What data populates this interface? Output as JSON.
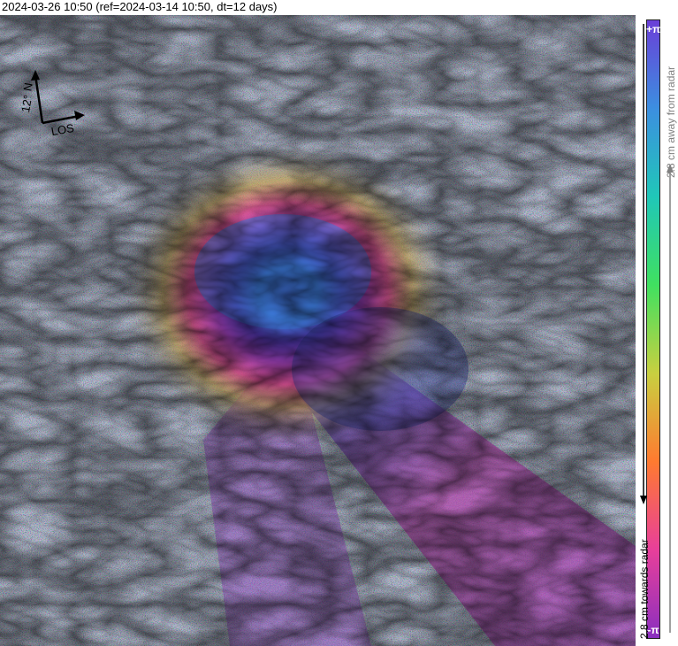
{
  "header": {
    "title": "2024-03-26 10:50 (ref=2024-03-14 10:50, dt=12 days)"
  },
  "image": {
    "subject": "InSAR interferogram of a volcano with concentric fringe pattern over shaded relief"
  },
  "compass": {
    "north_label": "N",
    "angle_label": "12°",
    "los_label": "LOS",
    "icon": "north-arrow-icon"
  },
  "colorbar": {
    "top_label": "+π",
    "bottom_label": "-π",
    "away_label": "2.8 cm away from radar",
    "towards_label": "2.8 cm towards radar",
    "colors_top_to_bottom": [
      "#6a3fd8",
      "#3c8fe0",
      "#20c7b8",
      "#40e060",
      "#c8d040",
      "#ff7a30",
      "#e83f9a",
      "#8a2fc0"
    ]
  }
}
